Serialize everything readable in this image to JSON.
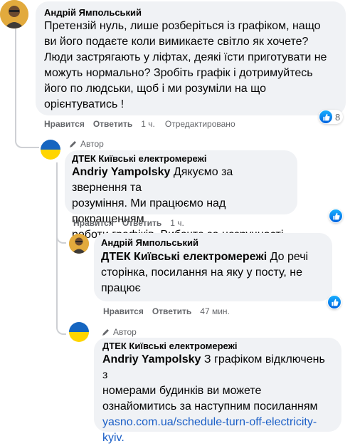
{
  "comments": [
    {
      "author": "Андрій Ямпольський",
      "text_lines": [
        "Претензій нуль, лише розберіться із графіком, нащо",
        "ви його подаєте коли вимикаєте світло як хочете?",
        "Люди застрягають у ліфтах, деякі їсти приготувати не",
        "можуть нормально? Зробіть графік і дотримуйтесь",
        "його по людськи, щоб і ми розуміли на що",
        "орієнтуватись !"
      ],
      "like_action": "Нравится",
      "reply_action": "Ответить",
      "time": "1 ч.",
      "edited": "Отредактировано",
      "likes": "8"
    },
    {
      "badge": "Автор",
      "author": "ДТЕК Київські електромережі",
      "mention": "Andriy Yampolsky",
      "text_first": " Дякуємо за звернення та",
      "text_lines": [
        "розуміння. Ми працюємо над покращенням",
        "роботи графіків. Вибачте за незручності"
      ],
      "like_action": "Нравится",
      "reply_action": "Ответить",
      "time": "1 ч."
    },
    {
      "author": "Андрій Ямпольський",
      "mention": "ДТЕК Київські електромережі",
      "text_first": " До речі",
      "text_lines": [
        "сторінка, посилання на яку у посту, не",
        "працює"
      ],
      "like_action": "Нравится",
      "reply_action": "Ответить",
      "time": "47 мин."
    },
    {
      "badge": "Автор",
      "author": "ДТЕК Київські електромережі",
      "mention": "Andriy Yampolsky",
      "text_first": " З графіком відключень з",
      "text_lines": [
        "номерами будинків ви можете",
        "ознайомитись за наступним посиланням"
      ],
      "link_lines": [
        "yasno.com.ua/schedule-turn-off-electricity-",
        "kyiv."
      ]
    }
  ],
  "colors": {
    "bubble": "#f0f2f5",
    "link": "#1b5fc7",
    "like_blue": "#0a7cff",
    "flag_blue": "#1565c0",
    "flag_yellow": "#ffd500"
  },
  "icons": {
    "like": "thumbs-up-icon",
    "badge": "pencil-icon"
  }
}
